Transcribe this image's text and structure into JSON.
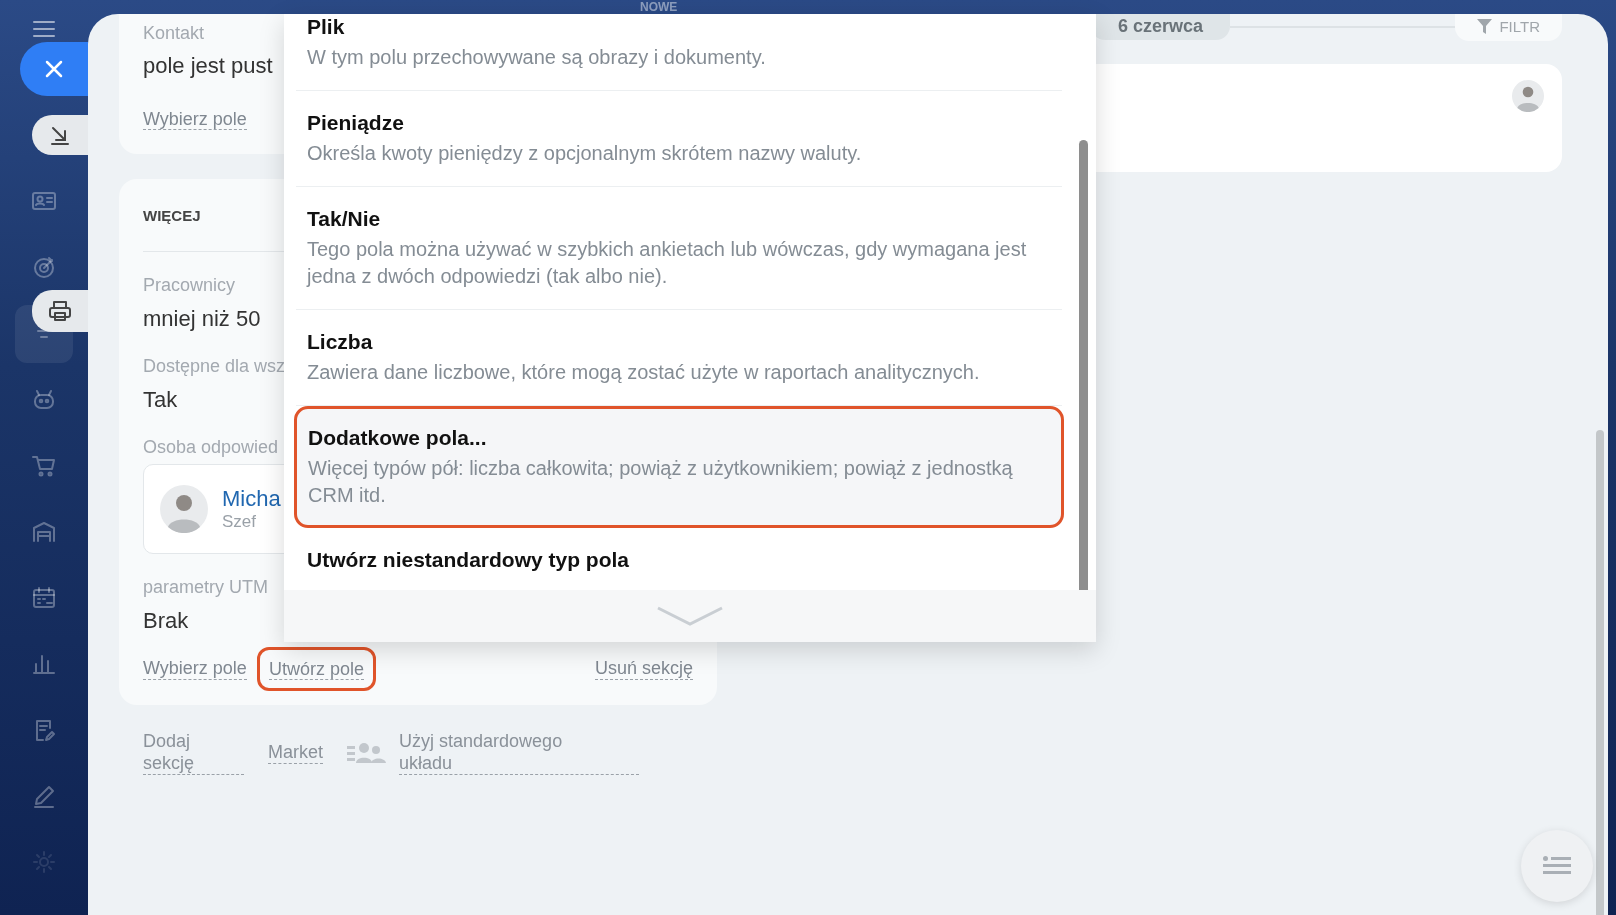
{
  "top_bar": {
    "label": "NOWE"
  },
  "timeline": {
    "date": "6 czerwca",
    "filter": "FILTR"
  },
  "contact_section": {
    "label": "Kontakt",
    "value": "pole jest pust",
    "link": "Wybierz pole"
  },
  "more_section": {
    "title": "WIĘCEJ",
    "fields": [
      {
        "kind": "text",
        "label": "Pracownicy",
        "value": "mniej niż 50"
      },
      {
        "kind": "text",
        "label": "Dostępne dla wsz",
        "value": "Tak"
      },
      {
        "kind": "person",
        "label": "Osoba odpowied",
        "name": "Micha",
        "role": "Szef"
      },
      {
        "kind": "text",
        "label": "parametry UTM",
        "value": "Brak"
      }
    ],
    "links": [
      {
        "label": "Wybierz pole",
        "highlighted": false
      },
      {
        "label": "Utwórz pole",
        "highlighted": true
      }
    ],
    "remove_link": "Usuń sekcję"
  },
  "footer_links": [
    {
      "kind": "link",
      "label": "Dodaj sekcję"
    },
    {
      "kind": "link",
      "label": "Market"
    },
    {
      "kind": "icon-link",
      "label": "Użyj standardowego układu"
    }
  ],
  "field_type_menu": {
    "items": [
      {
        "title": "Plik",
        "description": "W tym polu przechowywane są obrazy i dokumenty.",
        "highlighted": false
      },
      {
        "title": "Pieniądze",
        "description": "Określa kwoty pieniędzy z opcjonalnym skrótem nazwy waluty.",
        "highlighted": false
      },
      {
        "title": "Tak/Nie",
        "description": "Tego pola można używać w szybkich ankietach lub wówczas, gdy wymagana jest jedna z dwóch odpowiedzi (tak albo nie).",
        "highlighted": false
      },
      {
        "title": "Liczba",
        "description": "Zawiera dane liczbowe, które mogą zostać użyte w raportach analitycznych.",
        "highlighted": false
      },
      {
        "title": "Dodatkowe pola...",
        "description": "Więcej typów pół: liczba całkowita; powiąż z użytkownikiem; powiąż z jednostką CRM itd.",
        "highlighted": true
      },
      {
        "title": "Utwórz niestandardowy typ pola",
        "highlighted": false
      }
    ]
  }
}
